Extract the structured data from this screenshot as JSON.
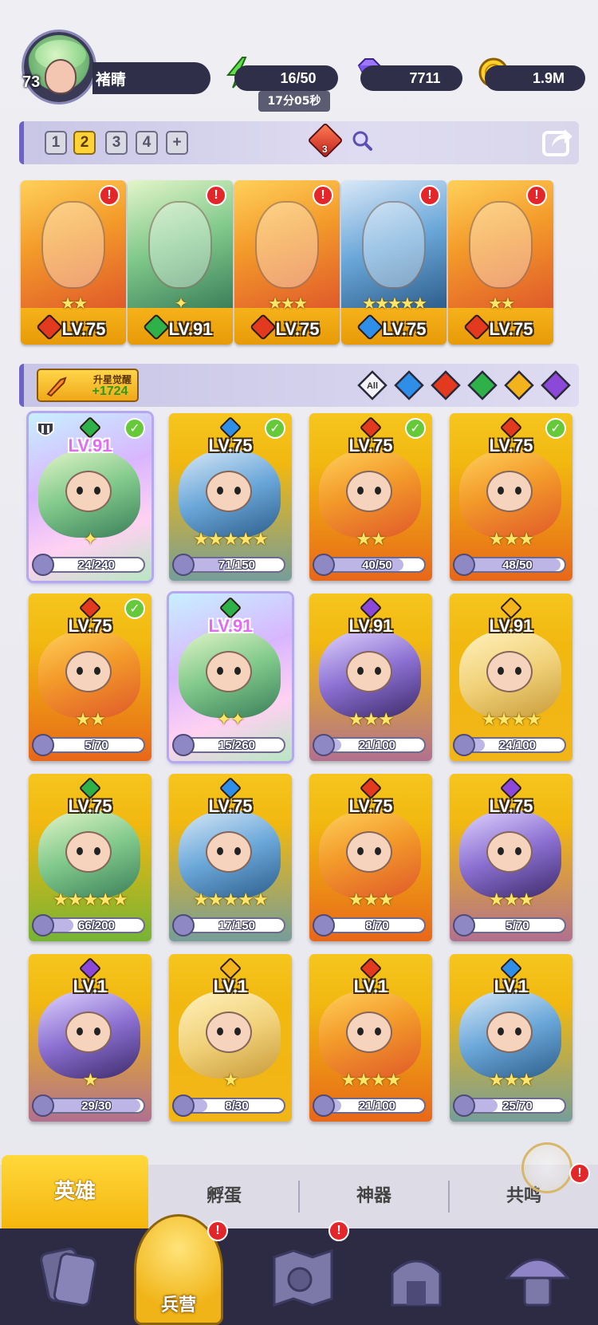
{
  "player": {
    "level": "73",
    "name": "褚睛"
  },
  "resources": {
    "energy": "16/50",
    "energy_timer": "17分05秒",
    "gems": "7711",
    "gold": "1.9M"
  },
  "team_bar": {
    "tabs": [
      "1",
      "2",
      "3",
      "4",
      "+"
    ],
    "active_tab": "2",
    "gem_count": "3"
  },
  "team": [
    {
      "level": "LV.75",
      "stars": "★★",
      "element": "fire",
      "alert": "!"
    },
    {
      "level": "LV.91",
      "stars": "✦",
      "element": "nature",
      "alert": "!"
    },
    {
      "level": "LV.75",
      "stars": "★★★",
      "element": "fire",
      "alert": "!"
    },
    {
      "level": "LV.75",
      "stars": "★★★★★",
      "element": "water",
      "alert": "!"
    },
    {
      "level": "LV.75",
      "stars": "★★",
      "element": "fire",
      "alert": "!"
    }
  ],
  "filter_bar": {
    "awaken_label": "升星觉醒",
    "awaken_value": "+1724",
    "filters": [
      "All",
      "water",
      "fire",
      "nature",
      "light",
      "dark"
    ],
    "all_label": "All"
  },
  "heroes": [
    {
      "level": "LV.91",
      "stars": "✦",
      "progress": "24/240",
      "ratio": 0.1,
      "element": "nature",
      "legend": true,
      "checked": true,
      "rank": true
    },
    {
      "level": "LV.75",
      "stars": "★★★★★",
      "progress": "71/150",
      "ratio": 0.47,
      "element": "water",
      "legend": false,
      "checked": true
    },
    {
      "level": "LV.75",
      "stars": "★★",
      "progress": "40/50",
      "ratio": 0.8,
      "element": "fire",
      "legend": false,
      "checked": true
    },
    {
      "level": "LV.75",
      "stars": "★★★",
      "progress": "48/50",
      "ratio": 0.96,
      "element": "fire",
      "legend": false,
      "checked": true
    },
    {
      "level": "LV.75",
      "stars": "★★",
      "progress": "5/70",
      "ratio": 0.07,
      "element": "fire",
      "legend": false,
      "checked": true
    },
    {
      "level": "LV.91",
      "stars": "✦✦",
      "progress": "15/260",
      "ratio": 0.06,
      "element": "nature",
      "legend": true,
      "checked": false
    },
    {
      "level": "LV.91",
      "stars": "★★★",
      "progress": "21/100",
      "ratio": 0.21,
      "element": "dark",
      "legend": false,
      "checked": false
    },
    {
      "level": "LV.91",
      "stars": "★★★★",
      "progress": "24/100",
      "ratio": 0.24,
      "element": "light",
      "legend": false,
      "checked": false
    },
    {
      "level": "LV.75",
      "stars": "★★★★★",
      "progress": "66/200",
      "ratio": 0.33,
      "element": "nature",
      "legend": false,
      "checked": false
    },
    {
      "level": "LV.75",
      "stars": "★★★★★",
      "progress": "17/150",
      "ratio": 0.11,
      "element": "water",
      "legend": false,
      "checked": false
    },
    {
      "level": "LV.75",
      "stars": "★★★",
      "progress": "8/70",
      "ratio": 0.11,
      "element": "fire",
      "legend": false,
      "checked": false
    },
    {
      "level": "LV.75",
      "stars": "★★★",
      "progress": "5/70",
      "ratio": 0.07,
      "element": "dark",
      "legend": false,
      "checked": false
    },
    {
      "level": "LV.1",
      "stars": "★",
      "progress": "29/30",
      "ratio": 0.97,
      "element": "dark",
      "legend": false,
      "checked": false
    },
    {
      "level": "LV.1",
      "stars": "★",
      "progress": "8/30",
      "ratio": 0.27,
      "element": "light",
      "legend": false,
      "checked": false
    },
    {
      "level": "LV.1",
      "stars": "★★★★",
      "progress": "21/100",
      "ratio": 0.21,
      "element": "fire",
      "legend": false,
      "checked": false
    },
    {
      "level": "LV.1",
      "stars": "★★★",
      "progress": "25/70",
      "ratio": 0.36,
      "element": "water",
      "legend": false,
      "checked": false
    }
  ],
  "sub_tabs": [
    "英雄",
    "孵蛋",
    "神器",
    "共鸣"
  ],
  "nav": {
    "barracks_label": "兵营",
    "alert": "!"
  },
  "colors": {
    "fire": "#e2391f",
    "water": "#2f8ee8",
    "nature": "#2fb14a",
    "light": "#f2b31c",
    "dark": "#8c48d8",
    "accent": "#f5b60e",
    "panel": "#2d2b44"
  }
}
